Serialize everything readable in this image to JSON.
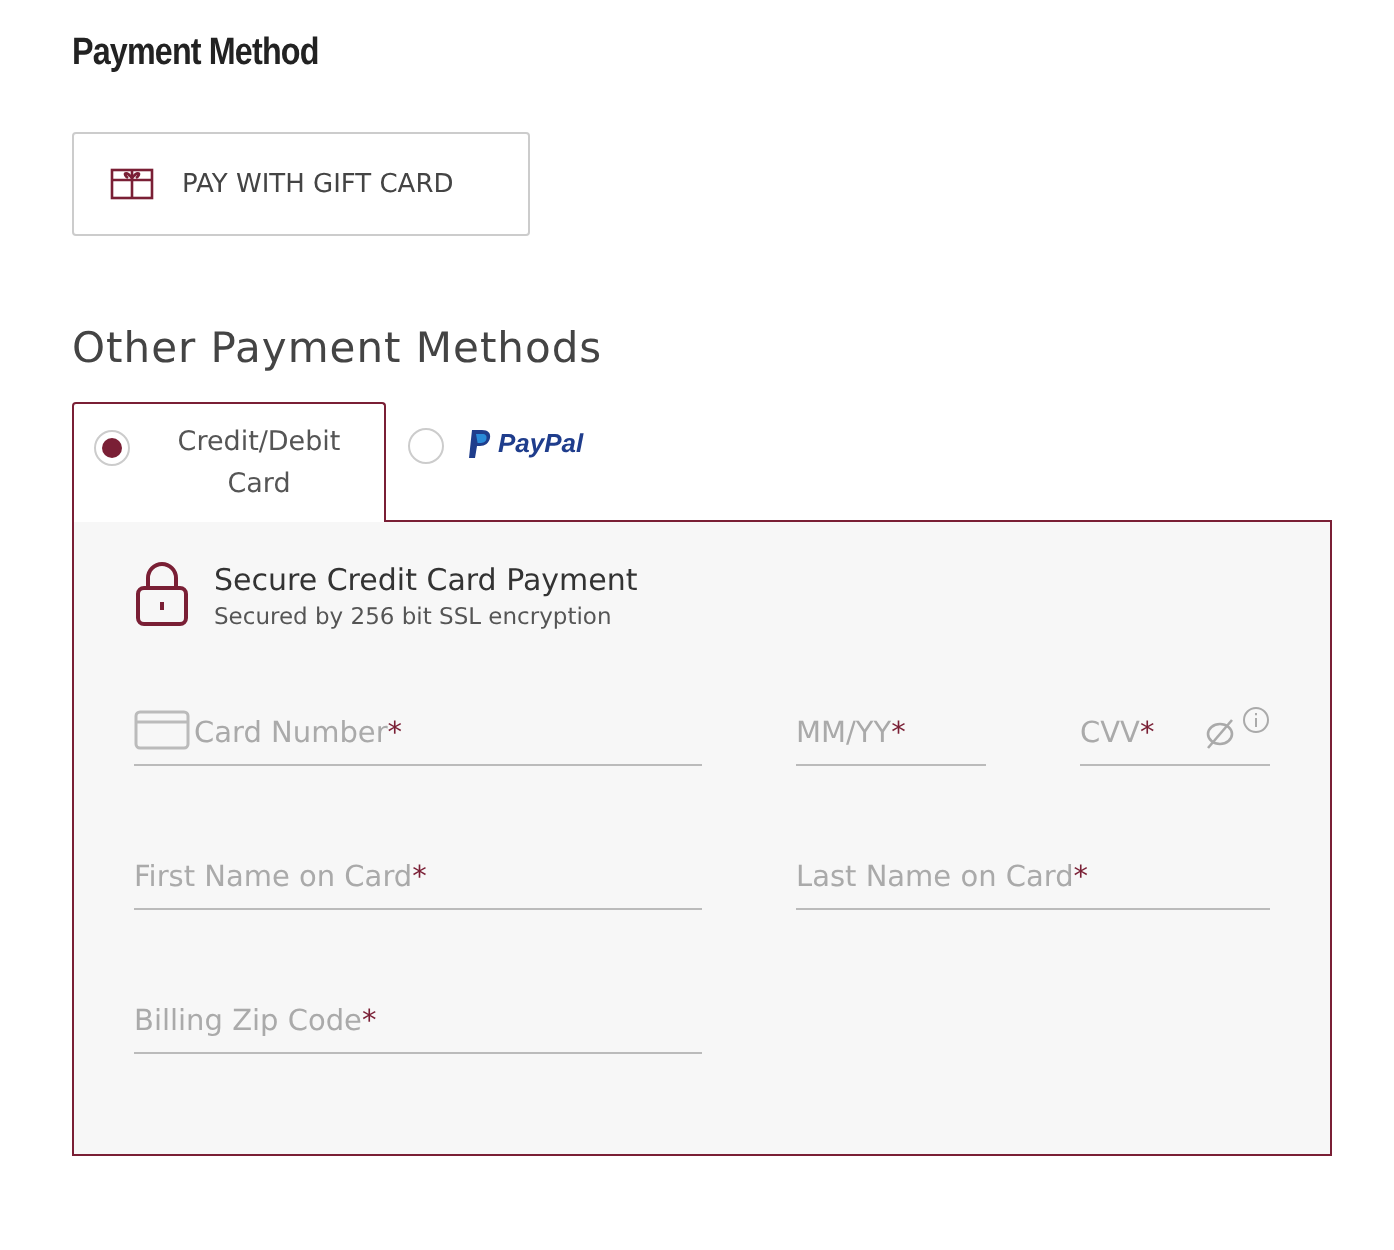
{
  "heading": "Payment Method",
  "gift_button": {
    "label": "PAY WITH GIFT CARD"
  },
  "subheading": "Other Payment Methods",
  "tabs": [
    {
      "kind": "card",
      "label": "Credit/Debit Card",
      "selected": true
    },
    {
      "kind": "paypal",
      "label": "PayPal",
      "selected": false
    }
  ],
  "panel": {
    "title": "Secure Credit Card Payment",
    "subtitle": "Secured by 256 bit SSL encryption",
    "rows": [
      [
        {
          "kind": "card",
          "placeholder": "Card Number",
          "required_mark": "*"
        },
        {
          "kind": "plain",
          "placeholder": "MM/YY",
          "required_mark": "*"
        },
        {
          "kind": "cvv",
          "placeholder": "CVV",
          "required_mark": "*"
        }
      ],
      [
        {
          "kind": "plain",
          "placeholder": "First Name on Card",
          "required_mark": "*"
        },
        {
          "kind": "wide",
          "placeholder": "Last Name on Card",
          "required_mark": "*"
        }
      ],
      [
        {
          "kind": "plain",
          "placeholder": "Billing Zip Code",
          "required_mark": "*"
        }
      ]
    ]
  }
}
